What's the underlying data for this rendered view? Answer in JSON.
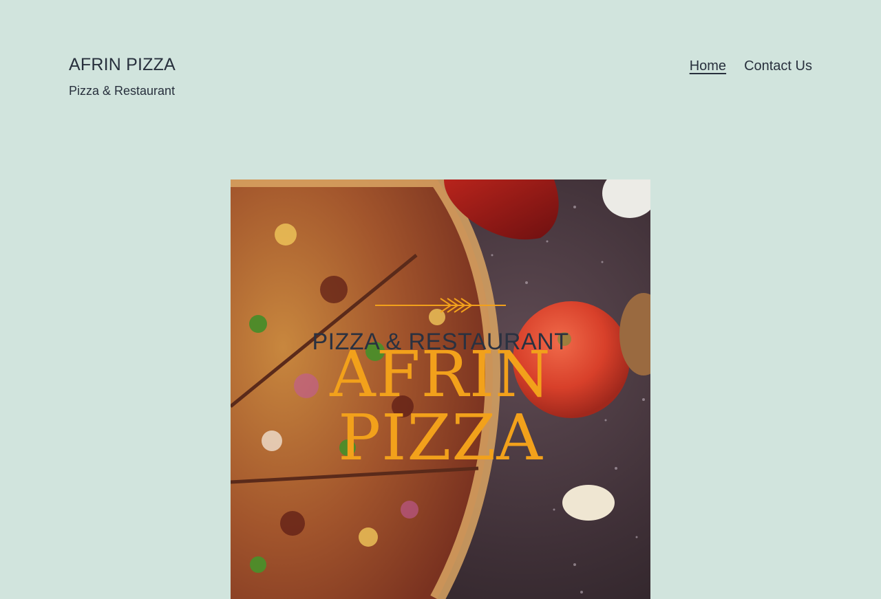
{
  "site": {
    "title": "AFRIN PIZZA",
    "tagline": "Pizza & Restaurant"
  },
  "nav": {
    "items": [
      {
        "label": "Home",
        "current": true
      },
      {
        "label": "Contact Us",
        "current": false
      }
    ]
  },
  "hero": {
    "subtitle": "PIZZA & RESTAURANT",
    "title_line1": "AFRIN",
    "title_line2": "PIZZA"
  },
  "colors": {
    "background": "#d1e4dd",
    "text": "#28303d",
    "accent": "#f2a11b"
  }
}
